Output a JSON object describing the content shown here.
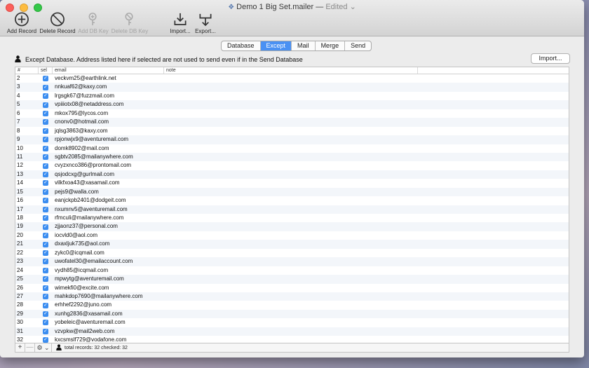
{
  "window": {
    "title": "Demo 1 Big Set.mailer",
    "title_sep": " — ",
    "status": "Edited"
  },
  "toolbar": {
    "add_record": "Add Record",
    "delete_record": "Delete Record",
    "add_db_key": "Add DB Key",
    "delete_db_key": "Delete DB Key",
    "import": "Import...",
    "export": "Export..."
  },
  "tabs": [
    "Database",
    "Except",
    "Mail",
    "Merge",
    "Send"
  ],
  "active_tab": "Except",
  "info": {
    "text": "Except Database. Address listed here if selected are not used to send even if in the Send Database",
    "import_button": "Import..."
  },
  "table": {
    "headers": {
      "num": "#",
      "sel": "sel",
      "email": "email",
      "note": "note"
    },
    "rows": [
      {
        "n": "2",
        "email": "veckvm25@earthlink.net"
      },
      {
        "n": "3",
        "email": "nnkuaf62@kaxy.com"
      },
      {
        "n": "4",
        "email": "lrgsgk67@fuzzmail.com"
      },
      {
        "n": "5",
        "email": "vpiiiotx08@netaddress.com"
      },
      {
        "n": "6",
        "email": "mkox795@lycos.com"
      },
      {
        "n": "7",
        "email": "cnonv0@hotmail.com"
      },
      {
        "n": "8",
        "email": "jqlsg3863@kaxy.com"
      },
      {
        "n": "9",
        "email": "rpjonwjx9@aventuremail.com"
      },
      {
        "n": "10",
        "email": "domk8902@mail.com"
      },
      {
        "n": "11",
        "email": "sgbtv2085@mailanywhere.com"
      },
      {
        "n": "12",
        "email": "cvyzxnco386@prontomail.com"
      },
      {
        "n": "13",
        "email": "qsjodcxg@gurlmail.com"
      },
      {
        "n": "14",
        "email": "vilkfxoa43@xasamail.com"
      },
      {
        "n": "15",
        "email": "pejs9@walla.com"
      },
      {
        "n": "16",
        "email": "eanjckpb2401@dodgeit.com"
      },
      {
        "n": "17",
        "email": "nxumnv5@aventuremail.com"
      },
      {
        "n": "18",
        "email": "rfmculi@mailanywhere.com"
      },
      {
        "n": "19",
        "email": "zjjaonz37@personal.com"
      },
      {
        "n": "20",
        "email": "iocvld0@aol.com"
      },
      {
        "n": "21",
        "email": "dxaxljuk735@aol.com"
      },
      {
        "n": "22",
        "email": "zykc0@icqmail.com"
      },
      {
        "n": "23",
        "email": "uwofatel30@emailaccount.com"
      },
      {
        "n": "24",
        "email": "vydh85@icqmail.com"
      },
      {
        "n": "25",
        "email": "mpwytg@aventuremail.com"
      },
      {
        "n": "26",
        "email": "wimekfi0@excite.com"
      },
      {
        "n": "27",
        "email": "mahkdop7690@mailanywhere.com"
      },
      {
        "n": "28",
        "email": "erhhef2292@juno.com"
      },
      {
        "n": "29",
        "email": "xunhg2836@xasamail.com"
      },
      {
        "n": "30",
        "email": "yobeleic@aventuremail.com"
      },
      {
        "n": "31",
        "email": "vzvpkw@mail2web.com"
      },
      {
        "n": "32",
        "email": "kxcsmslf729@vodafone.com"
      }
    ]
  },
  "footer": {
    "plus": "+",
    "minus": "—",
    "status": "total records: 32 checked: 32"
  },
  "colors": {
    "accent": "#4a91f3",
    "checkbox": "#3b8df0"
  }
}
